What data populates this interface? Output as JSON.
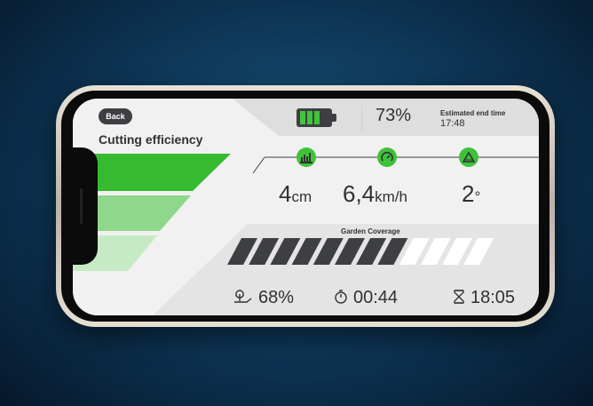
{
  "header": {
    "back_label": "Back",
    "title": "Cutting efficiency",
    "battery_percent": "73%",
    "battery_level": 0.73,
    "estimated_label": "Estimated end time",
    "estimated_time": "17:48"
  },
  "metrics": [
    {
      "icon": "height-icon",
      "value": "4",
      "unit": "cm"
    },
    {
      "icon": "speedometer-icon",
      "value": "6,4",
      "unit": "km/h"
    },
    {
      "icon": "slope-icon",
      "value": "2",
      "unit": "°"
    }
  ],
  "coverage": {
    "label": "Garden Coverage",
    "filled_segments": 8,
    "total_segments": 12
  },
  "stats": {
    "coverage_pct": "68%",
    "elapsed": "00:44",
    "end_time": "18:05"
  },
  "colors": {
    "accent": "#3fc23a",
    "dark": "#3d3f42",
    "text": "#2f3133",
    "background": "#0f3a5c"
  }
}
